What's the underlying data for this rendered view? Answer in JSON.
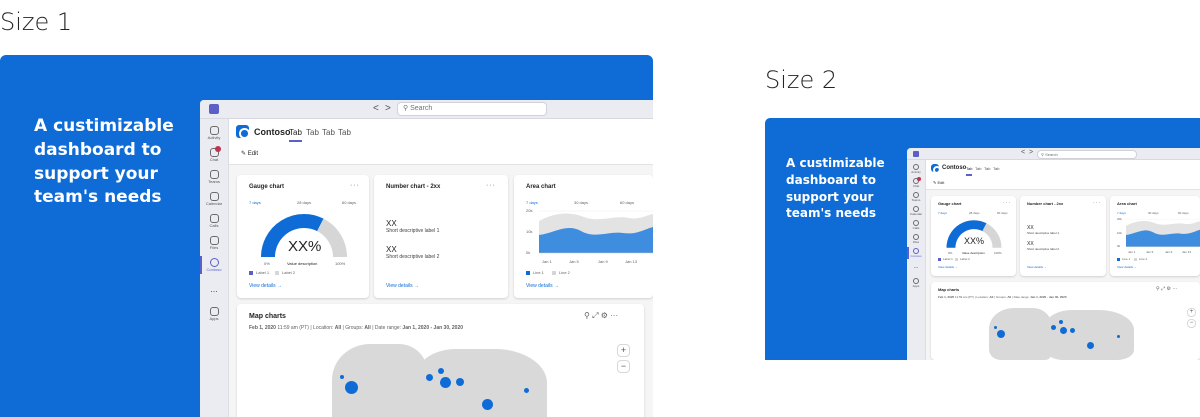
{
  "variants": [
    {
      "heading": "Size 1",
      "tagline": "A custimizable dashboard to support your team's needs",
      "search_placeholder": "Search",
      "nav_back": "<",
      "nav_forward": ">",
      "rail": [
        "Activity",
        "Chat",
        "Teams",
        "Calendar",
        "Calls",
        "Files",
        "Contoso",
        "...",
        "Apps"
      ],
      "brand": "Contoso",
      "tabs": [
        "Tab",
        "Tab",
        "Tab",
        "Tab"
      ],
      "edit": "Edit",
      "gauge": {
        "title": "Gauge chart",
        "more": "···",
        "periods": [
          "7 days",
          "28 days",
          "60 days"
        ],
        "value": "XX%",
        "fraction": 0.65,
        "min": "0%",
        "desc": "Value description",
        "max": "100%",
        "legend": [
          "Label 1",
          "Label 2"
        ],
        "link": "View details →"
      },
      "number": {
        "title": "Number chart - 2xx",
        "more": "···",
        "items": [
          {
            "value": "XX",
            "desc": "Short descriptive label 1"
          },
          {
            "value": "XX",
            "desc": "Short descriptive label 2"
          }
        ],
        "link": "View details →"
      },
      "area": {
        "title": "Area chart",
        "periods": [
          "7 days",
          "30 days",
          "60 days"
        ],
        "y_ticks": [
          "20k",
          "10k",
          "0k"
        ],
        "x_ticks": [
          "Jan 1",
          "Jan 5",
          "Jan 9",
          "Jan 13"
        ],
        "legend": [
          "Line 1",
          "Line 2"
        ],
        "link": "View details →"
      },
      "map": {
        "title": "Map charts",
        "meta_date": "Feb 1, 2020",
        "meta_time": "11:59 am (PT)",
        "meta_location_label": "Location:",
        "meta_location": "All",
        "meta_groups_label": "Groups:",
        "meta_groups": "All",
        "meta_range_label": "Date range:",
        "meta_range": "Jan 1, 2020 - Jan 30, 2020",
        "zoom_in": "+",
        "zoom_out": "−"
      }
    },
    {
      "heading": "Size 2",
      "tagline": "A custimizable dashboard to support your team's needs",
      "search_placeholder": "Search",
      "nav_back": "<",
      "nav_forward": ">",
      "rail": [
        "Activity",
        "Chat",
        "Teams",
        "Calendar",
        "Calls",
        "Files",
        "Contoso",
        "...",
        "Apps"
      ],
      "brand": "Contoso",
      "tabs": [
        "Tab",
        "Tab",
        "Tab",
        "Tab"
      ],
      "edit": "Edit",
      "gauge": {
        "title": "Gauge chart",
        "more": "···",
        "periods": [
          "7 days",
          "28 days",
          "60 days"
        ],
        "value": "XX%",
        "fraction": 0.65,
        "min": "0%",
        "desc": "Value description",
        "max": "100%",
        "legend": [
          "Label 1",
          "Label 2"
        ],
        "link": "View details →"
      },
      "number": {
        "title": "Number chart - 2xx",
        "more": "···",
        "items": [
          {
            "value": "XX",
            "desc": "Short descriptive label 1"
          },
          {
            "value": "XX",
            "desc": "Short descriptive label 2"
          }
        ],
        "link": "View details →"
      },
      "area": {
        "title": "Area chart",
        "periods": [
          "7 days",
          "30 days",
          "60 days"
        ],
        "y_ticks": [
          "20k",
          "10k",
          "0k"
        ],
        "x_ticks": [
          "Jan 1",
          "Jan 5",
          "Jan 9",
          "Jan 13"
        ],
        "legend": [
          "Line 1",
          "Line 2"
        ],
        "link": "View details →"
      },
      "map": {
        "title": "Map charts",
        "meta_date": "Feb 1, 2020",
        "meta_time": "11:59 am (PT)",
        "meta_location_label": "Location:",
        "meta_location": "All",
        "meta_groups_label": "Groups:",
        "meta_groups": "All",
        "meta_range_label": "Date range:",
        "meta_range": "Jan 1, 2020 - Jan 30, 2020",
        "zoom_in": "+",
        "zoom_out": "−"
      }
    }
  ],
  "colors": {
    "brand_blue": "#0f6cd6",
    "teams_purple": "#5b5fc7",
    "gauge_rest": "#d6d6d6",
    "map_land": "#d9d9d9",
    "notification_red": "#c4314b"
  }
}
